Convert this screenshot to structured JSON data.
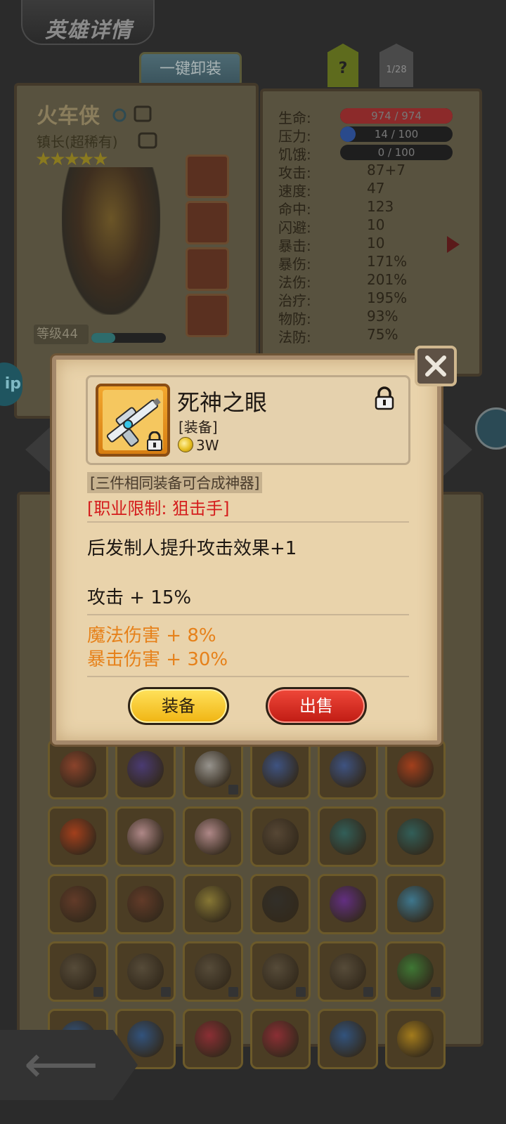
{
  "screen": {
    "title": "英雄详情",
    "unequip_all_label": "一键卸装",
    "help_label": "?",
    "page_indicator": "1/28"
  },
  "hero": {
    "name": "火车侠",
    "title": "镇长(超稀有)",
    "stars": "★★★★★",
    "star_count": 5,
    "level_label": "等级44",
    "exp_fraction": 0.32
  },
  "stats": [
    {
      "label": "生命:",
      "value": "974 / 974",
      "bar": true,
      "fill": 1.0,
      "color": "#8c2a2a"
    },
    {
      "label": "压力:",
      "value": "14 / 100",
      "bar": true,
      "fill": 0.14,
      "color": "#2a4a8c"
    },
    {
      "label": "饥饿:",
      "value": "0 / 100",
      "bar": true,
      "fill": 0.0,
      "color": "#555555"
    },
    {
      "label": "攻击:",
      "value": "87+7"
    },
    {
      "label": "速度:",
      "value": "47"
    },
    {
      "label": "命中:",
      "value": "123"
    },
    {
      "label": "闪避:",
      "value": "10"
    },
    {
      "label": "暴击:",
      "value": "10"
    },
    {
      "label": "暴伤:",
      "value": "171%"
    },
    {
      "label": "法伤:",
      "value": "201%"
    },
    {
      "label": "治疗:",
      "value": "195%"
    },
    {
      "label": "物防:",
      "value": "93%"
    },
    {
      "label": "法防:",
      "value": "75%"
    }
  ],
  "side_button_label": "ip",
  "dialog": {
    "close_icon": "crossed-swords-close-icon",
    "item_name": "死神之眼",
    "item_type": "[装备]",
    "item_price": "3W",
    "craft_note": "[三件相同装备可合成神器]",
    "class_limit": "[职业限制: 狙击手]",
    "effect": "后发制人提升攻击效果+1",
    "attack_bonus": "攻击 + 15%",
    "bonuses": [
      "魔法伤害 + 8%",
      "暴击伤害 + 30%"
    ],
    "equip_label": "装备",
    "sell_label": "出售"
  },
  "colors": {
    "dialog_bg": "#e9d3ab",
    "class_limit": "#d41c1c",
    "bonus": "#e6811a",
    "equip_button": "#f5c52a",
    "sell_button": "#dc2f25"
  },
  "inventory": {
    "items": [
      {
        "icon": "backpack-icon",
        "color": "#a0452e"
      },
      {
        "icon": "dark-orb-icon",
        "color": "#4a3a8c"
      },
      {
        "icon": "sniper-rifle-icon",
        "color": "#b0b0b0",
        "locked": true
      },
      {
        "icon": "blue-staff-icon",
        "color": "#3a5aa0"
      },
      {
        "icon": "blue-staff-icon",
        "color": "#3a5aa0"
      },
      {
        "icon": "fire-sword-icon",
        "color": "#c0401a"
      },
      {
        "icon": "fire-sword-icon",
        "color": "#c0401a"
      },
      {
        "icon": "medkit-icon",
        "color": "#d0a0a8"
      },
      {
        "icon": "medkit-icon",
        "color": "#d0a0a8"
      },
      {
        "icon": "dark-armor-icon",
        "color": "#5a4a3a"
      },
      {
        "icon": "spellbook-icon",
        "color": "#2a6a6a"
      },
      {
        "icon": "spellbook-icon",
        "color": "#2a6a6a"
      },
      {
        "icon": "pistol-icon",
        "color": "#6a3a2a"
      },
      {
        "icon": "pistol-icon",
        "color": "#6a3a2a"
      },
      {
        "icon": "rapier-icon",
        "color": "#9a8a3a"
      },
      {
        "icon": "baton-icon",
        "color": "#2a2a2a"
      },
      {
        "icon": "purple-dagger-icon",
        "color": "#6a2aa0"
      },
      {
        "icon": "blue-wand-icon",
        "color": "#3a8ab0"
      },
      {
        "icon": "shield-icon",
        "color": "#5a5040",
        "locked": true
      },
      {
        "icon": "shield-icon",
        "color": "#5a5040",
        "locked": true
      },
      {
        "icon": "shield-icon",
        "color": "#5a5040",
        "locked": true
      },
      {
        "icon": "shield-icon",
        "color": "#5a5040",
        "locked": true
      },
      {
        "icon": "shield-icon",
        "color": "#5a5040",
        "locked": true
      },
      {
        "icon": "green-ring-icon",
        "color": "#3a8a3a",
        "locked": true
      },
      {
        "icon": "blue-helmet-icon",
        "color": "#2a5a9a"
      },
      {
        "icon": "blue-helmet-icon",
        "color": "#2a5a9a"
      },
      {
        "icon": "red-helmet-icon",
        "color": "#a02a3a"
      },
      {
        "icon": "red-helmet-icon",
        "color": "#a02a3a"
      },
      {
        "icon": "blue-helmet-icon",
        "color": "#2a5a9a"
      },
      {
        "icon": "gold-helmet-icon",
        "color": "#c0901a"
      }
    ]
  }
}
